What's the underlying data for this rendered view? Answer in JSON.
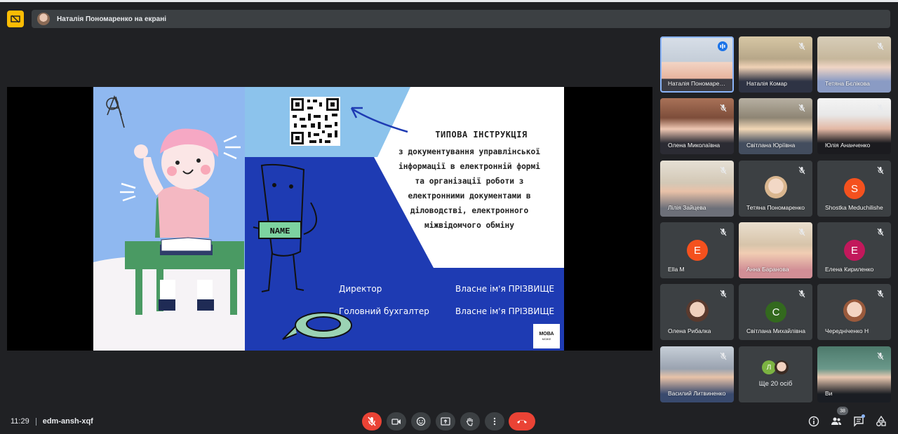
{
  "presenter": {
    "label": "Наталія Пономаренко на екрані"
  },
  "slide": {
    "title": "ТИПОВА ІНСТРУКЦІЯ",
    "body_lines": [
      "з документування управлінської",
      "інформації в електронній формі",
      "та організації роботи з",
      "електронними документами в",
      "діловодстві, електронного",
      "міжвідомчого обміну"
    ],
    "sign_label": "NAME",
    "rows": [
      {
        "role": "Директор",
        "name": "Власне ім'я ПРІЗВИЩЕ"
      },
      {
        "role": "Головний бухгалтер",
        "name": "Власне ім'я ПРІЗВИЩЕ"
      }
    ],
    "logo_line1": "МОВА",
    "logo_line2": "МОЖЕ"
  },
  "participants": [
    {
      "name": "Наталія Пономаренко",
      "type": "video",
      "speaking": true
    },
    {
      "name": "Наталія Комар",
      "type": "video"
    },
    {
      "name": "Тетяна Бєлікова",
      "type": "video"
    },
    {
      "name": "Олена Миколаївна",
      "type": "video"
    },
    {
      "name": "Світлана Юріївна",
      "type": "video"
    },
    {
      "name": "Юлія Ананченко",
      "type": "video"
    },
    {
      "name": "Лілія Зайцева",
      "type": "video"
    },
    {
      "name": "Тетяна Пономаренко",
      "type": "avatar"
    },
    {
      "name": "Shostka Meduchilishe",
      "type": "letter",
      "letter": "S",
      "color": "#f4511e"
    },
    {
      "name": "Ella M",
      "type": "letter",
      "letter": "E",
      "color": "#f4511e"
    },
    {
      "name": "Анна Баранова",
      "type": "video"
    },
    {
      "name": "Елена Кириленко",
      "type": "letter",
      "letter": "E",
      "color": "#c2185b"
    },
    {
      "name": "Олена Рибалка",
      "type": "avatar"
    },
    {
      "name": "Світлана Михайлівна",
      "type": "letter",
      "letter": "С",
      "color": "#33691e"
    },
    {
      "name": "Чередніченко Н",
      "type": "avatar"
    },
    {
      "name": "Василий Литвиненко",
      "type": "video"
    },
    {
      "name": "Ще 20 осіб",
      "type": "more",
      "letter": "Л"
    },
    {
      "name": "Ви",
      "type": "video"
    }
  ],
  "meeting": {
    "time": "11:29",
    "code": "edm-ansh-xqf",
    "participant_count": "38"
  },
  "colors": {
    "accent_yellow": "#fbbc04",
    "end_call_red": "#ea4335",
    "slide_blue_dark": "#1e3bb3",
    "slide_blue_light": "#8cc3ec",
    "speaking_blue": "#8ab4f8"
  }
}
